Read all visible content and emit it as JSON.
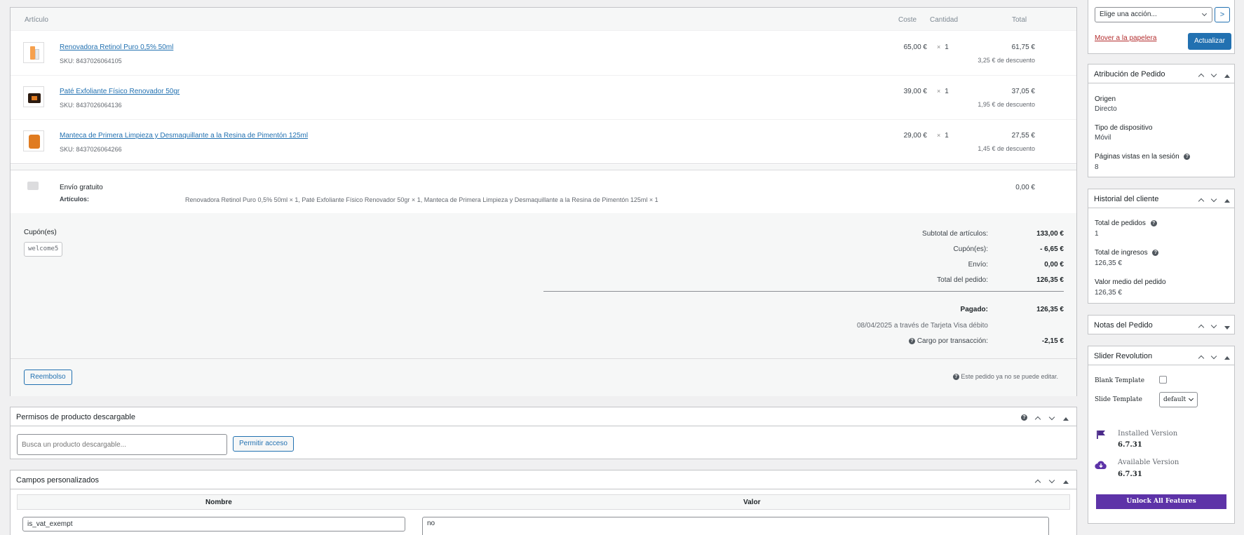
{
  "items_table": {
    "headers": {
      "item": "Artículo",
      "cost": "Coste",
      "qty": "Cantidad",
      "total": "Total"
    },
    "rows": [
      {
        "name": "Renovadora Retinol Puro 0,5% 50ml",
        "sku": "SKU: 8437026064105",
        "cost": "65,00 €",
        "qty_x": "×",
        "qty": "1",
        "total": "61,75 €",
        "discount": "3,25 € de descuento"
      },
      {
        "name": "Paté Exfoliante Físico Renovador 50gr",
        "sku": "SKU: 8437026064136",
        "cost": "39,00 €",
        "qty_x": "×",
        "qty": "1",
        "total": "37,05 €",
        "discount": "1,95 € de descuento"
      },
      {
        "name": "Manteca de Primera Limpieza y Desmaquillante a la Resina de Pimentón 125ml",
        "sku": "SKU: 8437026064266",
        "cost": "29,00 €",
        "qty_x": "×",
        "qty": "1",
        "total": "27,55 €",
        "discount": "1,45 € de descuento"
      }
    ],
    "shipping": {
      "name": "Envío gratuito",
      "items_label": "Artículos:",
      "items_value": "Renovadora Retinol Puro 0,5% 50ml × 1, Paté Exfoliante Físico Renovador 50gr × 1, Manteca de Primera Limpieza y Desmaquillante a la Resina de Pimentón 125ml × 1",
      "total": "0,00 €"
    }
  },
  "coupons": {
    "label": "Cupón(es)",
    "code": "welcome5"
  },
  "totals": {
    "subtotal_label": "Subtotal de artículos:",
    "subtotal": "133,00 €",
    "coupons_label": "Cupón(es):",
    "coupons": "- 6,65 €",
    "shipping_label": "Envío:",
    "shipping": "0,00 €",
    "order_total_label": "Total del pedido:",
    "order_total": "126,35 €",
    "paid_label": "Pagado:",
    "paid": "126,35 €",
    "paid_via": "08/04/2025 a través de Tarjeta Visa débito",
    "fee_label": "Cargo por transacción:",
    "fee": "-2,15 €",
    "help_glyph": "?"
  },
  "actions": {
    "refund": "Reembolso",
    "not_editable": "Este pedido ya no se puede editar."
  },
  "downloads": {
    "title": "Permisos de producto descargable",
    "search_placeholder": "Busca un producto descargable...",
    "grant": "Permitir acceso"
  },
  "custom_fields": {
    "title": "Campos personalizados",
    "col_name": "Nombre",
    "col_value": "Valor",
    "field_name": "is_vat_exempt",
    "field_value": "no"
  },
  "order_actions": {
    "select": "Elige una acción...",
    "go": ">",
    "trash": "Mover a la papelera",
    "update": "Actualizar"
  },
  "attribution": {
    "title": "Atribución de Pedido",
    "origin_label": "Origen",
    "origin": "Directo",
    "device_label": "Tipo de dispositivo",
    "device": "Móvil",
    "pages_label": "Páginas vistas en la sesión",
    "pages": "8"
  },
  "history": {
    "title": "Historial del cliente",
    "orders_label": "Total de pedidos",
    "orders": "1",
    "revenue_label": "Total de ingresos",
    "revenue": "126,35 €",
    "avg_label": "Valor medio del pedido",
    "avg": "126,35 €"
  },
  "notes": {
    "title": "Notas del Pedido"
  },
  "slider": {
    "title": "Slider Revolution",
    "blank_label": "Blank Template",
    "slide_label": "Slide Template",
    "slide_value": "default",
    "installed_label": "Installed Version",
    "installed": "6.7.31",
    "available_label": "Available Version",
    "available": "6.7.31",
    "unlock": "Unlock All Features",
    "accent": "#5d33a8"
  }
}
